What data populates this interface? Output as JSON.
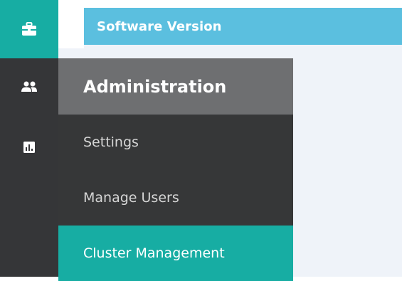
{
  "banner": {
    "title": "Software Version"
  },
  "rail": {
    "items": [
      {
        "icon": "briefcase-icon",
        "active": true
      },
      {
        "icon": "users-icon",
        "active": false
      },
      {
        "icon": "bar-chart-icon",
        "active": false
      }
    ]
  },
  "menu": {
    "header": "Administration",
    "items": [
      {
        "label": "Settings",
        "active": false
      },
      {
        "label": "Manage Users",
        "active": false
      },
      {
        "label": "Cluster Management",
        "active": true
      }
    ]
  },
  "colors": {
    "rail_background": "#353638",
    "accent_teal": "#17ada3",
    "banner_blue": "#5bbfdf",
    "menu_header_gray": "#6e6f71",
    "menu_background": "#363738",
    "content_background": "#eff3f9"
  }
}
